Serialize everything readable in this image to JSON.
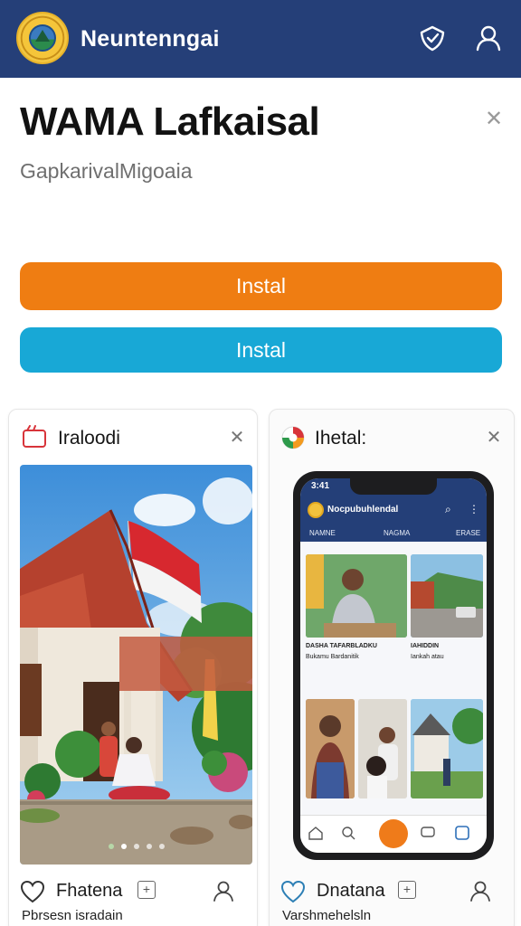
{
  "header": {
    "app_title": "Neuntenngai",
    "shield_icon": "shield-check-icon",
    "user_icon": "user-icon",
    "background": "#253f78"
  },
  "hero": {
    "title": "WAMA Lafkaisal",
    "subtitle": "GapkarivalMigoaia",
    "close_icon": "close-icon"
  },
  "buttons": {
    "primary_label": "Instal",
    "primary_color": "#ef7d12",
    "secondary_label": "Instal",
    "secondary_color": "#18a8d6"
  },
  "cards": [
    {
      "title": "Iraloodi",
      "icon": "browser-window-icon",
      "close_icon": "close-icon",
      "image": "house-with-indonesian-flag-photo",
      "carousel": {
        "count": 5,
        "active_index": 1
      },
      "footer_label": "Fhatena",
      "footer_sub": "Pbrsesn isradain",
      "heart_icon": "heart-icon",
      "plus_icon": "plus-box-icon",
      "user_icon": "user-icon"
    },
    {
      "title": "Ihetal:",
      "icon": "colorful-logo-icon",
      "close_icon": "close-icon",
      "image": "phone-app-screenshot",
      "footer_label": "Dnatana",
      "footer_sub": "Varshmehelsln",
      "heart_icon": "heart-icon",
      "plus_icon": "plus-box-icon",
      "user_icon": "user-icon"
    }
  ],
  "phone_mock": {
    "time": "3:41",
    "app_title": "Nocpubuhlendal",
    "tab_left": "NAMNE",
    "tab_mid": "NAGMA",
    "tab_right": "ERASE",
    "caption_1": "DASHA TAFARBLADKU",
    "caption_2": "Bukamu Bardanitik",
    "caption_3": "IAHIDDIN",
    "caption_4": "Iankah atau"
  }
}
